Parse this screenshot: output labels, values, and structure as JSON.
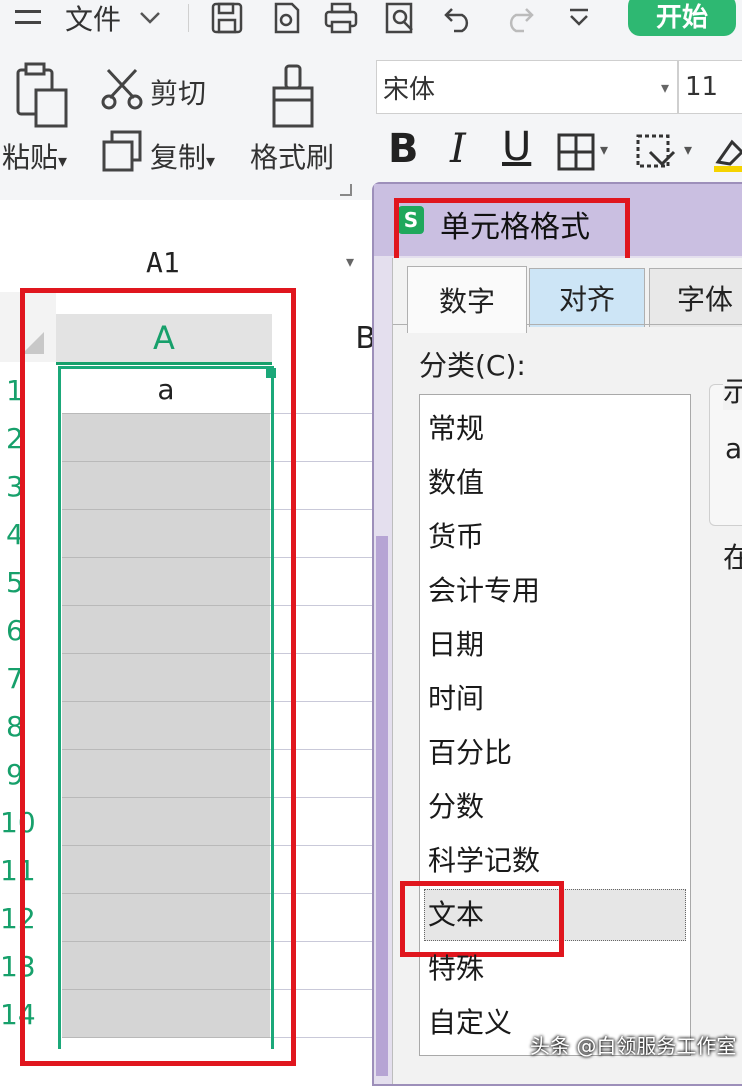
{
  "topbar": {
    "menu_icon": "hamburger-icon",
    "file_label": "文件",
    "start_label": "开始"
  },
  "ribbon": {
    "paste_label": "粘贴",
    "cut_label": "剪切",
    "copy_label": "复制",
    "format_painter_label": "格式刷",
    "font_name": "宋体",
    "font_size": "11",
    "bold": "B",
    "italic": "I",
    "underline": "U"
  },
  "sheet": {
    "name_box": "A1",
    "col_a": "A",
    "col_b": "B",
    "cell_a1": "a",
    "rows": [
      "1",
      "2",
      "3",
      "4",
      "5",
      "6",
      "7",
      "8",
      "9",
      "10",
      "11",
      "12",
      "13",
      "14"
    ]
  },
  "dialog": {
    "title": "单元格格式",
    "tabs": [
      "数字",
      "对齐",
      "字体"
    ],
    "category_label": "分类(C):",
    "categories": [
      "常规",
      "数值",
      "货币",
      "会计专用",
      "日期",
      "时间",
      "百分比",
      "分数",
      "科学记数",
      "文本",
      "特殊",
      "自定义"
    ],
    "selected_category": "文本",
    "side_text_1": "示",
    "side_text_2": "a",
    "side_text_3": "在"
  },
  "watermark": "头条 @白领服务工作室",
  "colors": {
    "accent_green": "#2eb872",
    "highlight_red": "#e0161e",
    "dialog_purple": "#cabfe1"
  }
}
